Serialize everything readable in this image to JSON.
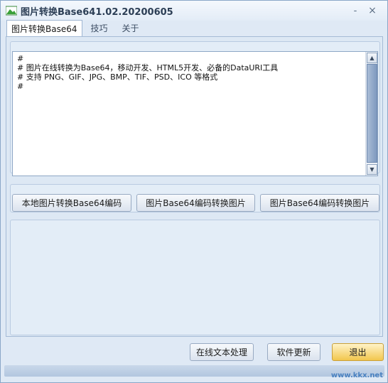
{
  "window": {
    "title": "图片转换Base641.02.20200605",
    "minimize_glyph": "-",
    "close_glyph": "×"
  },
  "tabs": [
    {
      "label": "图片转换Base64",
      "active": true
    },
    {
      "label": "技巧",
      "active": false
    },
    {
      "label": "关于",
      "active": false
    }
  ],
  "editor": {
    "lines": [
      "#",
      "# 图片在线转换为Base64，移动开发、HTML5开发、必备的DataURI工具",
      "# 支持 PNG、GIF、JPG、BMP、TIF、PSD、ICO 等格式",
      "#"
    ],
    "scroll_up_glyph": "▲",
    "scroll_down_glyph": "▼"
  },
  "actions": {
    "local_to_base64": "本地图片转换Base64编码",
    "base64_to_image_1": "图片Base64编码转换图片",
    "base64_to_image_2": "图片Base64编码转换图片"
  },
  "footer": {
    "online_text": "在线文本处理",
    "update": "软件更新",
    "exit": "退出",
    "watermark": "www.kkx.net"
  },
  "colors": {
    "accent": "#7f9abf",
    "exit_highlight": "#f2c64d"
  },
  "icons": {
    "app": "app-icon"
  }
}
